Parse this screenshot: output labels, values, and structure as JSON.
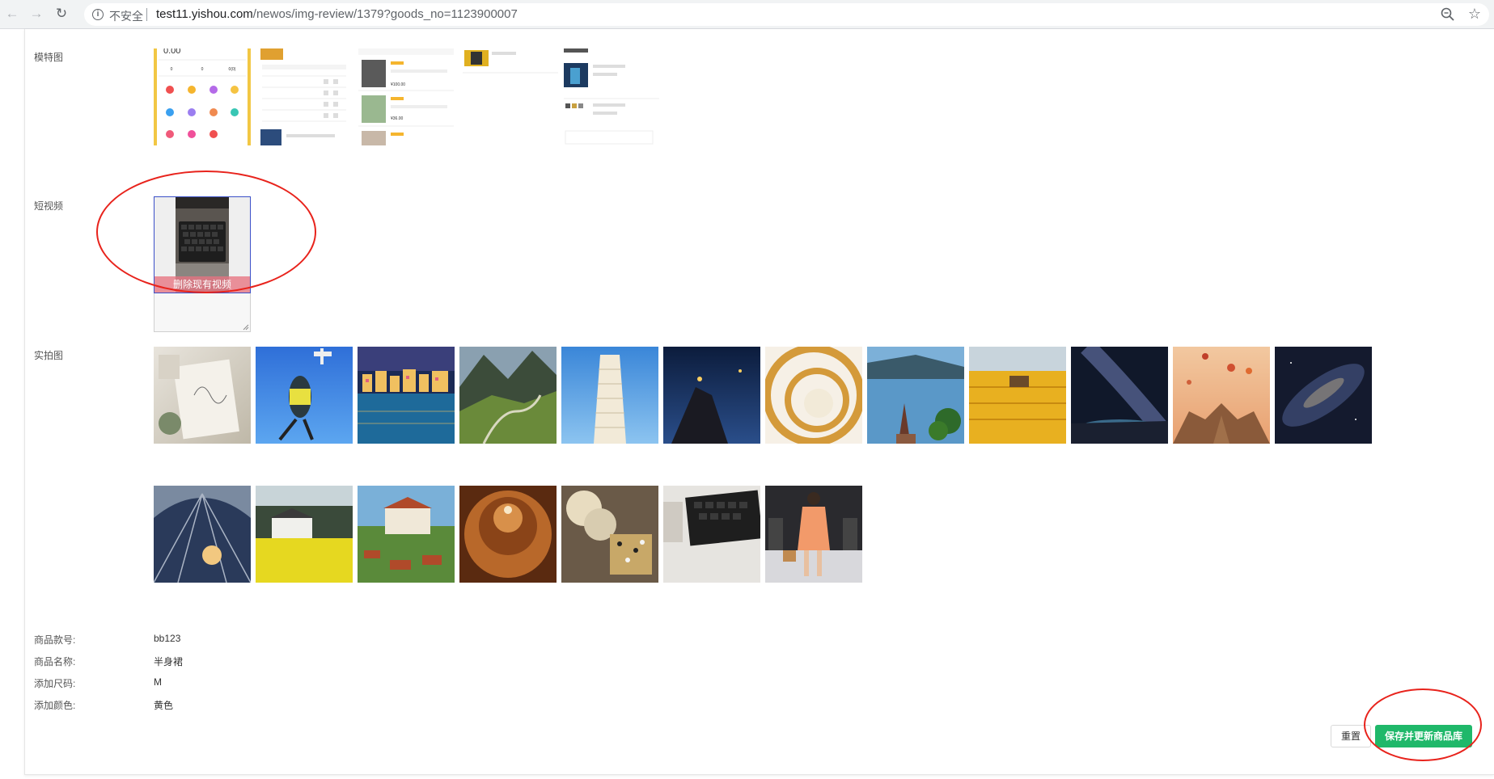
{
  "browser": {
    "security_label": "不安全",
    "url_host": "test11.yishou.com",
    "url_path": "/newos/img-review/1379?goods_no=1123900007"
  },
  "sections": {
    "model_label": "模特图",
    "video_label": "短视频",
    "real_label": "实拍图"
  },
  "video": {
    "delete_label": "删除现有视频"
  },
  "model_shots": {
    "shot1": {
      "price": "0.00",
      "stats": [
        "0",
        "0",
        "0(0)"
      ]
    },
    "shot3": {
      "price1": "¥100.00",
      "price2": "¥36.00"
    }
  },
  "info": [
    {
      "label": "商品款号:",
      "value": "bb123"
    },
    {
      "label": "商品名称:",
      "value": "半身裙"
    },
    {
      "label": "添加尺码:",
      "value": "M"
    },
    {
      "label": "添加颜色:",
      "value": "黄色"
    }
  ],
  "buttons": {
    "reset_label": "重置",
    "save_label": "保存并更新商品库"
  },
  "colors": {
    "primary_button": "#1fb86a",
    "annotation_red": "#e8231c",
    "video_border": "#3b50c8"
  },
  "icons": {
    "back": "back-arrow-icon",
    "forward": "forward-arrow-icon",
    "reload": "reload-icon",
    "info": "info-icon",
    "zoom": "zoom-icon",
    "bookmark": "star-icon"
  }
}
